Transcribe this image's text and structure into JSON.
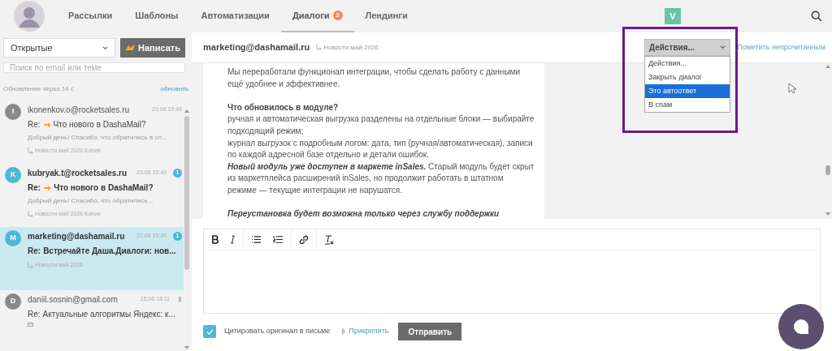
{
  "nav": {
    "items": [
      {
        "label": "Рассылки",
        "selected": false
      },
      {
        "label": "Шаблоны",
        "selected": false
      },
      {
        "label": "Автоматизации",
        "selected": false
      },
      {
        "label": "Диалоги",
        "selected": true,
        "badge": "2"
      },
      {
        "label": "Лендинги",
        "selected": false
      }
    ],
    "user_initial": "V"
  },
  "sidebar": {
    "filter": "Открытые",
    "write_button": "Написать",
    "search_placeholder": "Поиск по email или теме",
    "refresh_note": "Обновление через 14 с",
    "refresh_link": "обновить",
    "dialogs": [
      {
        "initial": "I",
        "email": "ikonenkov.o@rocketsales.ru",
        "date": "23.06 15:49",
        "unread": false,
        "subject_prefix": "Re:",
        "hand": true,
        "subject": "Что нового в DashaMail?",
        "preview": "Добрый день! Спасибо, что обратились в сл...",
        "campaign": "Новости май 2026 Копия",
        "selected": false,
        "kind": "campaign"
      },
      {
        "initial": "K",
        "email": "kubryak.t@rocketsales.ru",
        "date": "23.06 15:49",
        "unread": true,
        "badge": "1",
        "subject_prefix": "Re:",
        "hand": true,
        "subject": "Что нового в DashaMail?",
        "preview": "Добрый день! Спасибо, что обратились...",
        "campaign": "Новости май 2026 Копия",
        "selected": false,
        "kind": "campaign"
      },
      {
        "initial": "M",
        "email": "marketing@dashamail.ru",
        "date": "22.06 15:39",
        "unread": true,
        "badge": "1",
        "subject_prefix": "Re:",
        "hand": false,
        "subject": "Встречайте Даша.Диалоги: нов...",
        "campaign": "Новости май 2026",
        "selected": true,
        "kind": "campaign"
      },
      {
        "initial": "D",
        "email": "daniil.sosnin@gmail.com",
        "date": "15.06 18:11",
        "unread": false,
        "subject_prefix": "Re:",
        "hand": false,
        "subject": "Актуальные алгоритмы Яндекс: к...",
        "selected": false,
        "kind": "attachment"
      }
    ]
  },
  "conversation": {
    "email": "marketing@dashamail.ru",
    "campaign": "Новости май 2026",
    "actions": {
      "label": "Действия...",
      "options": [
        {
          "label": "Действия...",
          "selected": false
        },
        {
          "label": "Закрыть диалог",
          "selected": false
        },
        {
          "label": "Это автоответ",
          "selected": true
        },
        {
          "label": "В спам",
          "selected": false
        }
      ]
    },
    "mark_unread": "Пометить непрочитанным",
    "body": [
      [
        {
          "kind": "text",
          "text": "Мы переработали функционал интеграции, чтобы сделать работу с данными ещё удобнее и эффективнее."
        }
      ],
      [
        {
          "kind": "heading",
          "text": "Что обновилось в модуле?"
        },
        {
          "kind": "text",
          "text": "ручная и автоматическая выгрузка разделены на отдельные блоки — выбирайте подходящий режим;"
        },
        {
          "kind": "text",
          "text": "журнал выгрузок с подробным логом: дата, тип (ручная/автоматическая), записи по каждой адресной базе отдельно и детали ошибок."
        },
        {
          "kind": "lead",
          "lead": "Новый модуль уже доступен в маркете inSales.",
          "text": " Старый модуль будет скрыт из маркетплейса расширений inSales, но продолжит работать в штатном режиме — текущие интеграции не нарушатся."
        }
      ],
      [
        {
          "kind": "emphasis",
          "text": "Переустановка будет возможна только через службу поддержки"
        }
      ]
    ]
  },
  "composer": {
    "quote_original": {
      "label": "Цитировать оригинал в письме",
      "checked": true
    },
    "attach": "Прикрепить",
    "send": "Отправить"
  }
}
